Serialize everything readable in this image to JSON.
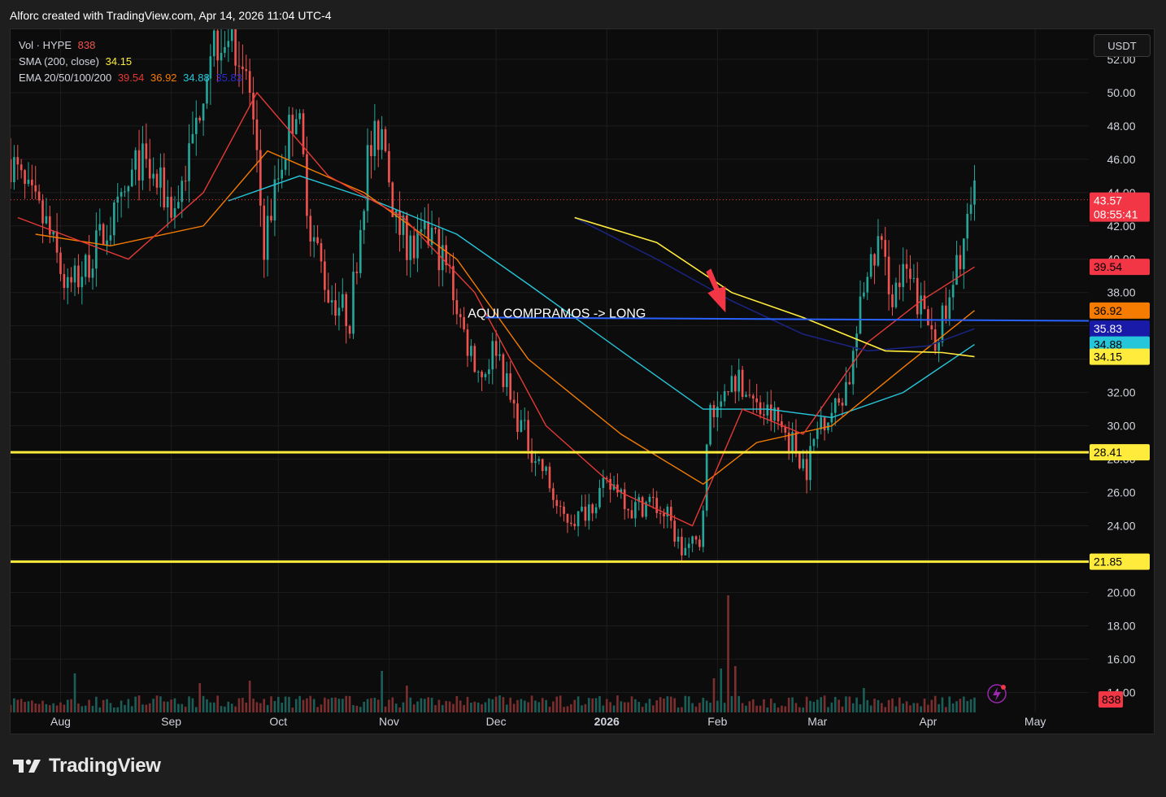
{
  "header": {
    "text": "Alforc created with TradingView.com, Apr 14, 2026 11:04 UTC-4"
  },
  "legend": {
    "vol": {
      "label": "Vol · HYPE",
      "value": "838"
    },
    "sma": {
      "label": "SMA (200, close)",
      "value": "34.15"
    },
    "ema": {
      "label": "EMA 20/50/100/200",
      "values": [
        "39.54",
        "36.92",
        "34.88",
        "35.83"
      ]
    }
  },
  "currency_button": "USDT",
  "footer": {
    "brand": "TradingView",
    "logo": "tradingview-logo-icon"
  },
  "colors": {
    "up": "#26a69a",
    "down": "#ef5350",
    "ema20": "#e53935",
    "ema50": "#f57c00",
    "ema100": "#26c6da",
    "ema200": "#1a237e",
    "sma200": "#ffeb3b",
    "hline": "#ffeb3b",
    "trend": "#2962ff",
    "annotation": "#f23645"
  },
  "chart_data": {
    "type": "candlestick",
    "symbol": "HYPE",
    "quote": "USDT",
    "ylim": [
      12.8,
      53.8
    ],
    "y_ticks": [
      "52.00",
      "50.00",
      "48.00",
      "46.00",
      "44.00",
      "42.00",
      "40.00",
      "38.00",
      "36.00",
      "34.00",
      "32.00",
      "30.00",
      "28.00",
      "26.00",
      "24.00",
      "22.00",
      "20.00",
      "18.00",
      "16.00",
      "14.00"
    ],
    "x_labels": [
      "Aug",
      "Sep",
      "Oct",
      "Nov",
      "Dec",
      "2026",
      "Feb",
      "Mar",
      "Apr",
      "May"
    ],
    "x_label_dates": [
      "2025-08-01",
      "2025-09-01",
      "2025-10-01",
      "2025-11-01",
      "2025-12-01",
      "2026-01-01",
      "2026-02-01",
      "2026-03-01",
      "2026-04-01",
      "2026-05-01"
    ],
    "x_range": [
      "2025-07-18",
      "2026-05-16"
    ],
    "price_path": [
      [
        "2025-07-18",
        46.0
      ],
      [
        "2025-07-22",
        44.0
      ],
      [
        "2025-07-28",
        42.0
      ],
      [
        "2025-08-03",
        38.0
      ],
      [
        "2025-08-08",
        39.5
      ],
      [
        "2025-08-13",
        41.5
      ],
      [
        "2025-08-18",
        43.0
      ],
      [
        "2025-08-23",
        46.0
      ],
      [
        "2025-08-28",
        44.5
      ],
      [
        "2025-09-02",
        43.0
      ],
      [
        "2025-09-07",
        47.0
      ],
      [
        "2025-09-12",
        53.0
      ],
      [
        "2025-09-18",
        54.0
      ],
      [
        "2025-09-23",
        50.0
      ],
      [
        "2025-09-27",
        41.0
      ],
      [
        "2025-10-02",
        46.0
      ],
      [
        "2025-10-06",
        49.5
      ],
      [
        "2025-10-10",
        42.0
      ],
      [
        "2025-10-15",
        38.0
      ],
      [
        "2025-10-21",
        36.5
      ],
      [
        "2025-10-26",
        46.0
      ],
      [
        "2025-10-30",
        48.0
      ],
      [
        "2025-11-03",
        42.0
      ],
      [
        "2025-11-08",
        40.5
      ],
      [
        "2025-11-13",
        41.5
      ],
      [
        "2025-11-18",
        39.0
      ],
      [
        "2025-11-22",
        35.5
      ],
      [
        "2025-11-27",
        33.0
      ],
      [
        "2025-12-01",
        35.0
      ],
      [
        "2025-12-05",
        31.5
      ],
      [
        "2025-12-10",
        29.0
      ],
      [
        "2025-12-15",
        27.0
      ],
      [
        "2025-12-19",
        24.5
      ],
      [
        "2025-12-24",
        24.5
      ],
      [
        "2025-12-30",
        26.0
      ],
      [
        "2026-01-04",
        26.5
      ],
      [
        "2026-01-08",
        25.0
      ],
      [
        "2026-01-13",
        25.5
      ],
      [
        "2026-01-18",
        24.5
      ],
      [
        "2026-01-22",
        22.5
      ],
      [
        "2026-01-27",
        23.0
      ],
      [
        "2026-01-30",
        31.0
      ],
      [
        "2026-02-03",
        32.5
      ],
      [
        "2026-02-07",
        33.0
      ],
      [
        "2026-02-12",
        31.0
      ],
      [
        "2026-02-17",
        30.5
      ],
      [
        "2026-02-22",
        29.0
      ],
      [
        "2026-02-26",
        27.5
      ],
      [
        "2026-03-02",
        30.5
      ],
      [
        "2026-03-06",
        31.0
      ],
      [
        "2026-03-10",
        33.0
      ],
      [
        "2026-03-14",
        38.0
      ],
      [
        "2026-03-18",
        41.0
      ],
      [
        "2026-03-22",
        38.0
      ],
      [
        "2026-03-26",
        39.0
      ],
      [
        "2026-03-30",
        37.0
      ],
      [
        "2026-04-03",
        35.5
      ],
      [
        "2026-04-07",
        37.0
      ],
      [
        "2026-04-10",
        40.5
      ],
      [
        "2026-04-14",
        43.57
      ]
    ],
    "volume_spikes": [
      [
        "2025-08-05",
        16
      ],
      [
        "2025-09-09",
        12
      ],
      [
        "2025-09-23",
        13
      ],
      [
        "2025-10-30",
        17
      ],
      [
        "2025-11-06",
        11
      ],
      [
        "2026-02-04",
        48
      ],
      [
        "2026-02-02",
        18
      ],
      [
        "2026-02-06",
        19
      ],
      [
        "2026-03-14",
        10
      ],
      [
        "2026-01-31",
        14
      ]
    ],
    "ema20": [
      [
        "2025-07-20",
        42.5
      ],
      [
        "2025-08-20",
        40.0
      ],
      [
        "2025-09-10",
        44.0
      ],
      [
        "2025-09-25",
        50.0
      ],
      [
        "2025-10-15",
        45.0
      ],
      [
        "2025-11-05",
        42.5
      ],
      [
        "2025-11-25",
        38.0
      ],
      [
        "2025-12-15",
        30.0
      ],
      [
        "2026-01-05",
        26.0
      ],
      [
        "2026-01-25",
        24.0
      ],
      [
        "2026-02-08",
        31.0
      ],
      [
        "2026-02-25",
        29.5
      ],
      [
        "2026-03-15",
        35.0
      ],
      [
        "2026-03-30",
        37.5
      ],
      [
        "2026-04-14",
        39.54
      ]
    ],
    "ema50": [
      [
        "2025-07-25",
        41.5
      ],
      [
        "2025-08-15",
        40.8
      ],
      [
        "2025-09-10",
        42.0
      ],
      [
        "2025-09-28",
        46.5
      ],
      [
        "2025-10-25",
        44.0
      ],
      [
        "2025-11-20",
        40.0
      ],
      [
        "2025-12-10",
        34.0
      ],
      [
        "2026-01-05",
        29.5
      ],
      [
        "2026-01-28",
        26.5
      ],
      [
        "2026-02-12",
        29.0
      ],
      [
        "2026-03-05",
        30.0
      ],
      [
        "2026-03-25",
        33.5
      ],
      [
        "2026-04-14",
        36.92
      ]
    ],
    "ema100": [
      [
        "2025-09-17",
        43.5
      ],
      [
        "2025-10-07",
        45.0
      ],
      [
        "2025-10-28",
        43.5
      ],
      [
        "2025-11-20",
        41.5
      ],
      [
        "2025-12-10",
        38.5
      ],
      [
        "2026-01-05",
        34.5
      ],
      [
        "2026-01-28",
        31.0
      ],
      [
        "2026-02-15",
        31.0
      ],
      [
        "2026-03-05",
        30.5
      ],
      [
        "2026-03-25",
        32.0
      ],
      [
        "2026-04-14",
        34.88
      ]
    ],
    "ema200": [
      [
        "2025-12-23",
        42.5
      ],
      [
        "2026-01-15",
        40.0
      ],
      [
        "2026-02-05",
        37.5
      ],
      [
        "2026-02-25",
        35.5
      ],
      [
        "2026-03-15",
        34.5
      ],
      [
        "2026-04-01",
        34.8
      ],
      [
        "2026-04-14",
        35.83
      ]
    ],
    "sma200": [
      [
        "2025-12-23",
        42.5
      ],
      [
        "2026-01-15",
        41.0
      ],
      [
        "2026-02-05",
        38.0
      ],
      [
        "2026-02-25",
        36.5
      ],
      [
        "2026-03-20",
        34.5
      ],
      [
        "2026-04-05",
        34.4
      ],
      [
        "2026-04-14",
        34.15
      ]
    ],
    "horizontal_levels": [
      28.41,
      21.85
    ],
    "trendline": [
      [
        "2025-11-28",
        36.5
      ],
      [
        "2026-05-16",
        36.3
      ]
    ],
    "annotation": {
      "text": "AQUI COMPRAMOS -> LONG",
      "date": "2025-12-18",
      "price": 36.6
    },
    "arrow": {
      "date": "2026-02-01",
      "price": 36.8
    },
    "price_labels": [
      {
        "value": "43.57",
        "sub": "08:55:41",
        "price": 43.57,
        "bg": "#f23645",
        "fg": "#ffffff"
      },
      {
        "value": "39.54",
        "price": 39.54,
        "bg": "#f23645",
        "fg": "#000000"
      },
      {
        "value": "36.92",
        "price": 36.92,
        "bg": "#f57c00",
        "fg": "#000000"
      },
      {
        "value": "35.83",
        "price": 35.83,
        "bg": "#1a1aa8",
        "fg": "#ffffff"
      },
      {
        "value": "34.88",
        "price": 34.88,
        "bg": "#26c6da",
        "fg": "#000000"
      },
      {
        "value": "34.15",
        "price": 34.15,
        "bg": "#ffeb3b",
        "fg": "#000000"
      },
      {
        "value": "28.41",
        "price": 28.41,
        "bg": "#ffeb3b",
        "fg": "#000000"
      },
      {
        "value": "21.85",
        "price": 21.85,
        "bg": "#ffeb3b",
        "fg": "#000000"
      }
    ],
    "volume_label": {
      "value": "838",
      "bg": "#f23645"
    }
  }
}
